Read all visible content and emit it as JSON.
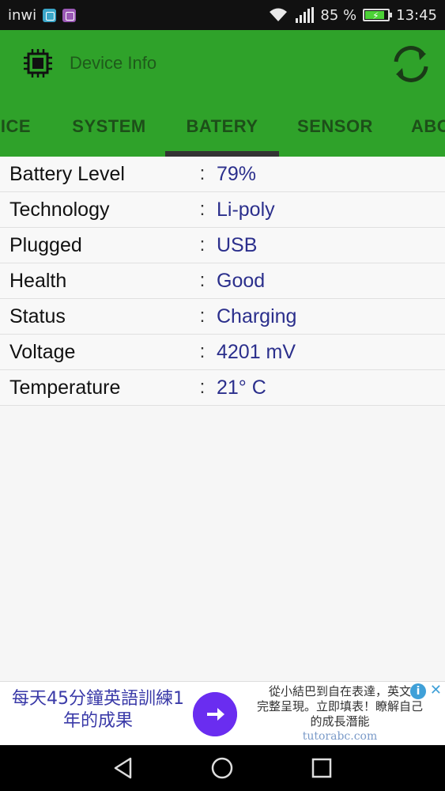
{
  "status_bar": {
    "carrier": "inwi",
    "battery_percent": "85 %",
    "battery_level": 0.85,
    "time": "13:45",
    "icons": [
      "android-icon",
      "gallery-icon",
      "wifi-icon",
      "signal-icon",
      "battery-charging-icon"
    ]
  },
  "app_bar": {
    "title": "Device Info",
    "color": "#2fa22a",
    "icons": [
      "chip-icon",
      "refresh-icon"
    ]
  },
  "tabs": [
    {
      "label": "ICE",
      "active": false
    },
    {
      "label": "SYSTEM",
      "active": false
    },
    {
      "label": "BATERY",
      "active": true
    },
    {
      "label": "SENSOR",
      "active": false
    },
    {
      "label": "ABO",
      "active": false
    }
  ],
  "battery_info": {
    "rows": [
      {
        "label": "Battery Level",
        "value": "79%"
      },
      {
        "label": "Technology",
        "value": "Li-poly"
      },
      {
        "label": "Plugged",
        "value": "USB"
      },
      {
        "label": "Health",
        "value": "Good"
      },
      {
        "label": "Status",
        "value": "Charging"
      },
      {
        "label": "Voltage",
        "value": "4201 mV"
      },
      {
        "label": "Temperature",
        "value": "21° C"
      }
    ],
    "separator": ":"
  },
  "ad": {
    "headline_line1": "每天45分鐘英語訓練1",
    "headline_line2": "年的成果",
    "body_line1": "從小結巴到自在表達，英文",
    "body_line2": "完整呈現。立即填表！瞭解自己",
    "body_line3": "的成長潛能",
    "url": "tutorabc.com",
    "info_glyph": "i",
    "close_glyph": "✕"
  },
  "nav_bar": {
    "icons": [
      "back-icon",
      "home-icon",
      "recents-icon"
    ]
  }
}
